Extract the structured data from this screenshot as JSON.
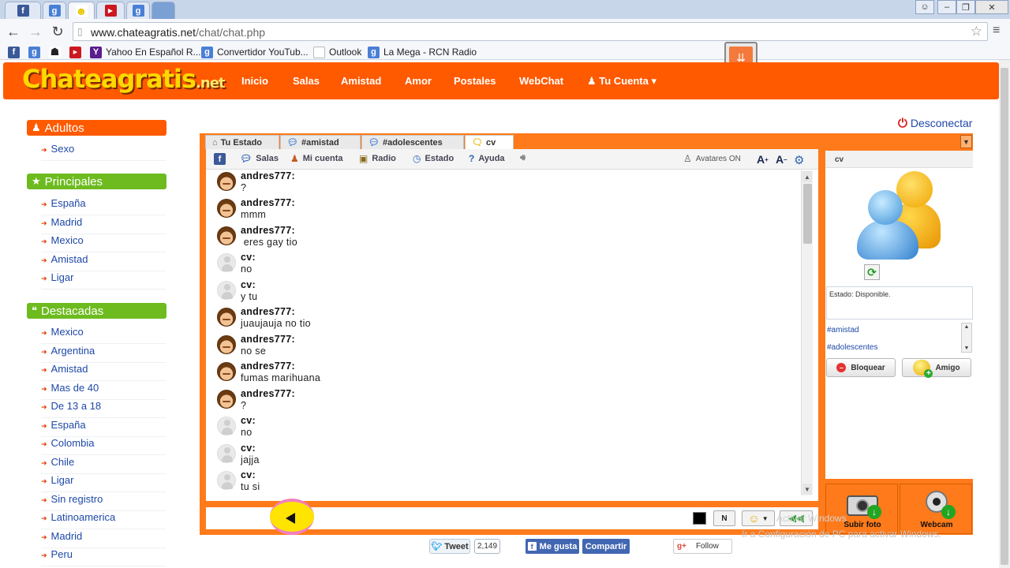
{
  "browser": {
    "tab_icons": [
      {
        "name": "facebook-icon",
        "glyph": "f",
        "color": "#3b5998"
      },
      {
        "name": "google-icon",
        "glyph": "g",
        "color": "#4a7fd6"
      },
      {
        "name": "chateagratis-icon",
        "glyph": "☻",
        "color": "#e8c600"
      },
      {
        "name": "youtube-icon",
        "glyph": "▶",
        "color": "#cc181e"
      },
      {
        "name": "google-icon",
        "glyph": "g",
        "color": "#4a7fd6"
      }
    ],
    "url_host": "www.chateagratis.net",
    "url_path": "/chat/chat.php",
    "bookmarks": [
      {
        "label": "Yahoo En Español R...",
        "icon": "yahoo-icon"
      },
      {
        "label": "Convertidor YouTub...",
        "icon": "google-icon"
      },
      {
        "label": "Outlook",
        "icon": "page-icon"
      },
      {
        "label": "La Mega - RCN Radio",
        "icon": "google-icon"
      }
    ]
  },
  "site": {
    "logo": "Chateagratis",
    "logo_suffix": ".net",
    "nav": [
      "Inicio",
      "Salas",
      "Amistad",
      "Amor",
      "Postales",
      "WebChat",
      "Tu Cuenta"
    ],
    "disconnect": "Desconectar",
    "brand_color": "#ff5a00"
  },
  "sidebar": {
    "adultos": {
      "title": "Adultos",
      "links": [
        "Sexo"
      ]
    },
    "principales": {
      "title": "Principales",
      "links": [
        "España",
        "Madrid",
        "Mexico",
        "Amistad",
        "Ligar"
      ]
    },
    "destacadas": {
      "title": "Destacadas",
      "links": [
        "Mexico",
        "Argentina",
        "Amistad",
        "Mas de 40",
        "De 13 a 18",
        "España",
        "Colombia",
        "Chile",
        "Ligar",
        "Sin registro",
        "Latinoamerica",
        "Madrid",
        "Peru"
      ]
    }
  },
  "chat": {
    "tabs": [
      "Tu Estado",
      "#amistad",
      "#adolescentes",
      "cv"
    ],
    "tools": {
      "salas": "Salas",
      "micuenta": "Mi cuenta",
      "radio": "Radio",
      "estado": "Estado",
      "ayuda": "Ayuda",
      "avatares": "Avatares ON"
    },
    "messages": [
      {
        "user": "andres777:",
        "text": "?",
        "avatar": "boy"
      },
      {
        "user": "andres777:",
        "text": "mmm",
        "avatar": "boy"
      },
      {
        "user": "andres777:",
        "text": " eres gay tio",
        "avatar": "boy"
      },
      {
        "user": "cv:",
        "text": "no",
        "avatar": "ghost"
      },
      {
        "user": "cv:",
        "text": "y tu",
        "avatar": "ghost"
      },
      {
        "user": "andres777:",
        "text": "juaujauja no tio",
        "avatar": "boy"
      },
      {
        "user": "andres777:",
        "text": "no se",
        "avatar": "boy"
      },
      {
        "user": "andres777:",
        "text": "fumas marihuana",
        "avatar": "boy"
      },
      {
        "user": "andres777:",
        "text": "?",
        "avatar": "boy"
      },
      {
        "user": "cv:",
        "text": "no",
        "avatar": "ghost"
      },
      {
        "user": "cv:",
        "text": "jajja",
        "avatar": "ghost"
      },
      {
        "user": "cv:",
        "text": "tu si",
        "avatar": "ghost"
      }
    ],
    "input_value": "",
    "bold_btn": "N",
    "text_color": "#000000"
  },
  "panel": {
    "user": "cv",
    "estado": "Estado:  Disponible.",
    "rooms": [
      "#amistad",
      "#adolescentes"
    ],
    "block": "Bloquear",
    "friend": "Amigo",
    "upload_photo": "Subir foto",
    "webcam": "Webcam"
  },
  "social": {
    "tweet": "Tweet",
    "tweet_count": "2,149",
    "fb_like": "Me gusta",
    "fb_share": "Compartir",
    "gplus_follow": "Follow"
  },
  "windows_watermark": {
    "line1": "Activar Windows",
    "line2": "Ir a Configuración de PC para activar Windows."
  }
}
